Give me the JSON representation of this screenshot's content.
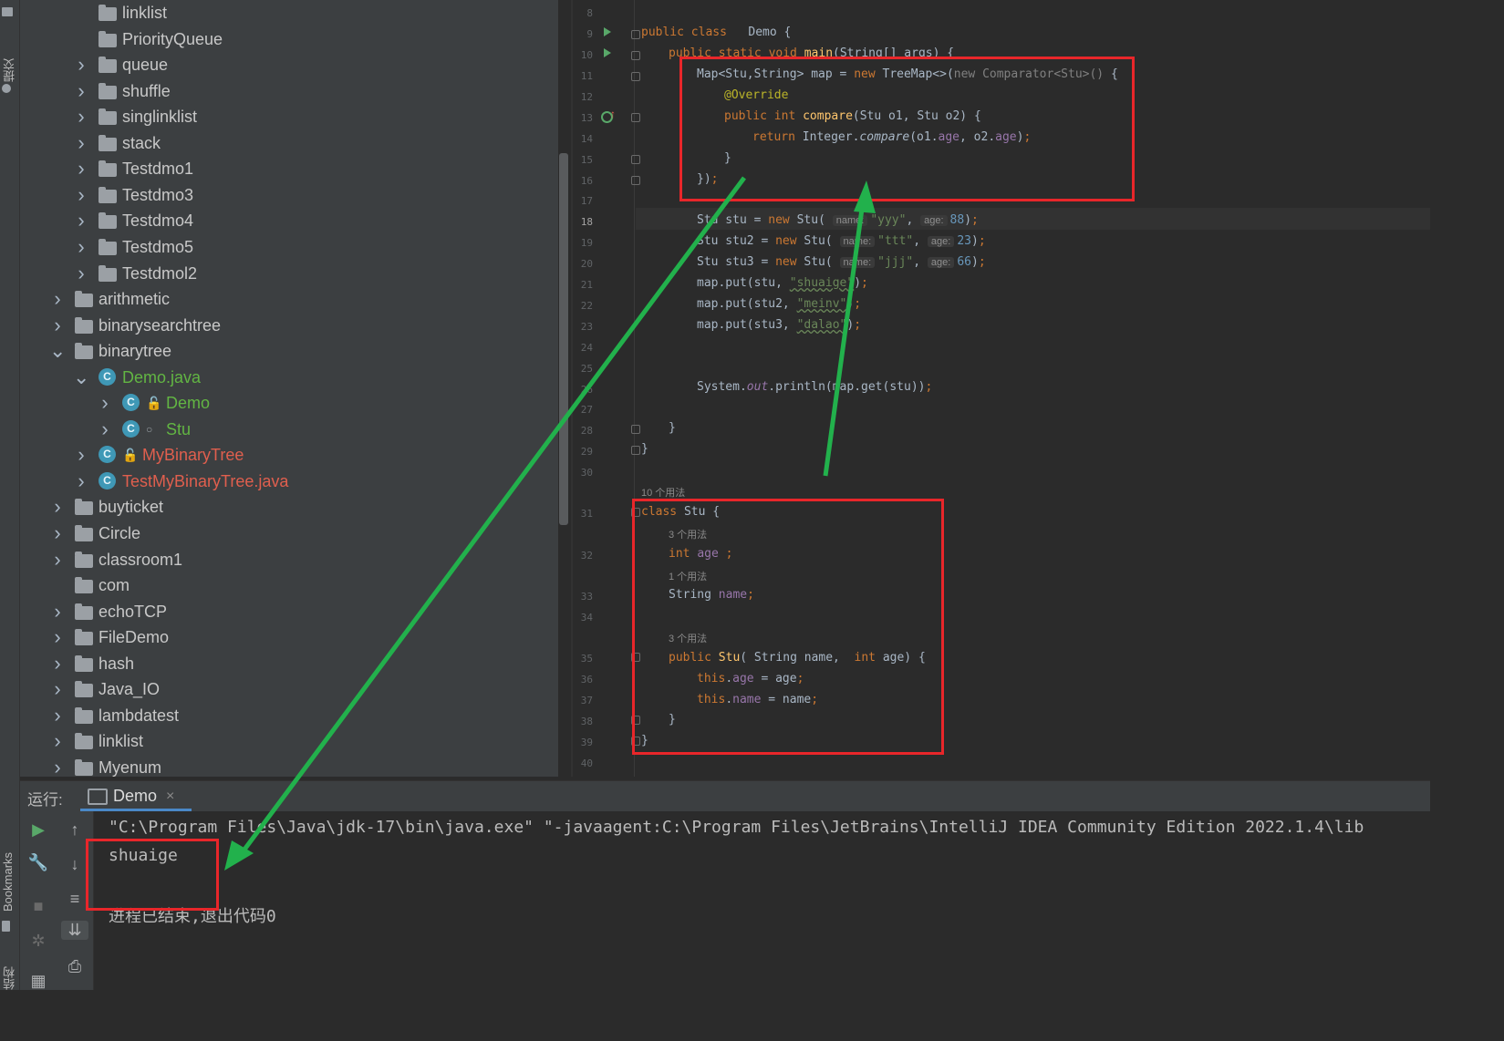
{
  "left_strip": {
    "commit_label": "提交",
    "bookmarks_label": "Bookmarks",
    "structure_label": "结构"
  },
  "tree": {
    "items": [
      {
        "label": "linklist",
        "type": "folder"
      },
      {
        "label": "PriorityQueue",
        "type": "folder"
      },
      {
        "label": "queue",
        "type": "folder"
      },
      {
        "label": "shuffle",
        "type": "folder"
      },
      {
        "label": "singlinklist",
        "type": "folder"
      },
      {
        "label": "stack",
        "type": "folder"
      },
      {
        "label": "Testdmo1",
        "type": "folder"
      },
      {
        "label": "Testdmo3",
        "type": "folder"
      },
      {
        "label": "Testdmo4",
        "type": "folder"
      },
      {
        "label": "Testdmo5",
        "type": "folder"
      },
      {
        "label": "Testdmol2",
        "type": "folder"
      },
      {
        "label": "arithmetic",
        "type": "folder"
      },
      {
        "label": "binarysearchtree",
        "type": "folder"
      },
      {
        "label": "binarytree",
        "type": "folder"
      },
      {
        "label": "Demo.java",
        "type": "java-file",
        "color": "#62b543"
      },
      {
        "label": "Demo",
        "type": "class",
        "color": "#62b543"
      },
      {
        "label": "Stu",
        "type": "class",
        "color": "#62b543"
      },
      {
        "label": "MyBinaryTree",
        "type": "class",
        "color": "#e05f4e"
      },
      {
        "label": "TestMyBinaryTree.java",
        "type": "java-file",
        "color": "#e05f4e"
      },
      {
        "label": "buyticket",
        "type": "folder"
      },
      {
        "label": "Circle",
        "type": "folder"
      },
      {
        "label": "classroom1",
        "type": "folder"
      },
      {
        "label": "com",
        "type": "folder"
      },
      {
        "label": "echoTCP",
        "type": "folder"
      },
      {
        "label": "FileDemo",
        "type": "folder"
      },
      {
        "label": "hash",
        "type": "folder"
      },
      {
        "label": "Java_IO",
        "type": "folder"
      },
      {
        "label": "lambdatest",
        "type": "folder"
      },
      {
        "label": "linklist",
        "type": "folder"
      },
      {
        "label": "Myenum",
        "type": "folder"
      }
    ]
  },
  "editor": {
    "line_numbers": [
      "8",
      "9",
      "10",
      "11",
      "12",
      "13",
      "14",
      "15",
      "16",
      "17",
      "18",
      "19",
      "20",
      "21",
      "22",
      "23",
      "24",
      "25",
      "26",
      "27",
      "28",
      "29",
      "30",
      "31",
      "32",
      "33",
      "34",
      "35",
      "36",
      "37",
      "38",
      "39",
      "40"
    ],
    "usage_hints": [
      "10 个用法",
      "3 个用法",
      "1 个用法",
      "3 个用法"
    ],
    "param_hints": {
      "name": "name:",
      "age": "age:"
    }
  },
  "run": {
    "label": "运行:",
    "tab": "Demo",
    "command": "\"C:\\Program Files\\Java\\jdk-17\\bin\\java.exe\" \"-javaagent:C:\\Program Files\\JetBrains\\IntelliJ IDEA Community Edition 2022.1.4\\lib",
    "output": "shuaige",
    "exit_message": "进程已结束,退出代码0"
  },
  "colors": {
    "highlight_box": "#e8262a",
    "arrow": "#22b14c",
    "keyword": "#cc7832",
    "string": "#6a8759",
    "number": "#6897bb",
    "field": "#9876aa"
  }
}
